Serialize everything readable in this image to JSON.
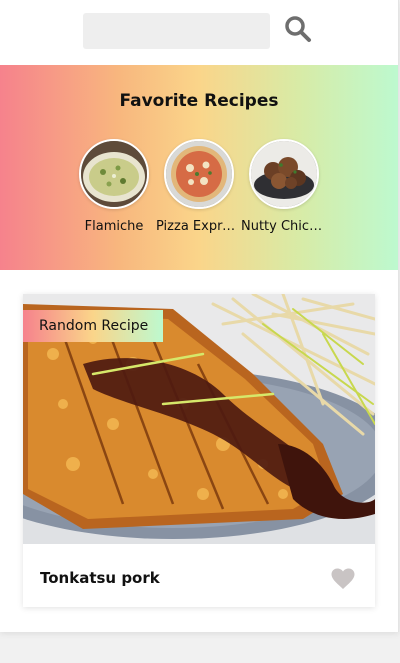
{
  "search": {
    "placeholder": "",
    "value": ""
  },
  "favorites": {
    "title": "Favorite Recipes",
    "items": [
      {
        "name": "Flamiche",
        "icon": "flamiche-thumbnail"
      },
      {
        "name": "Pizza Express Margherita",
        "icon": "pizza-thumbnail"
      },
      {
        "name": "Nutty Chicken Curry",
        "icon": "chicken-curry-thumbnail"
      }
    ]
  },
  "random": {
    "badge": "Random Recipe",
    "title": "Tonkatsu pork",
    "icon": "heart-icon"
  },
  "colors": {
    "gradient_start": "#f6828c",
    "gradient_mid": "#fad58a",
    "gradient_end": "#bdf9cf",
    "search_icon": "#6e6e6e",
    "heart": "#c9c4c4"
  }
}
